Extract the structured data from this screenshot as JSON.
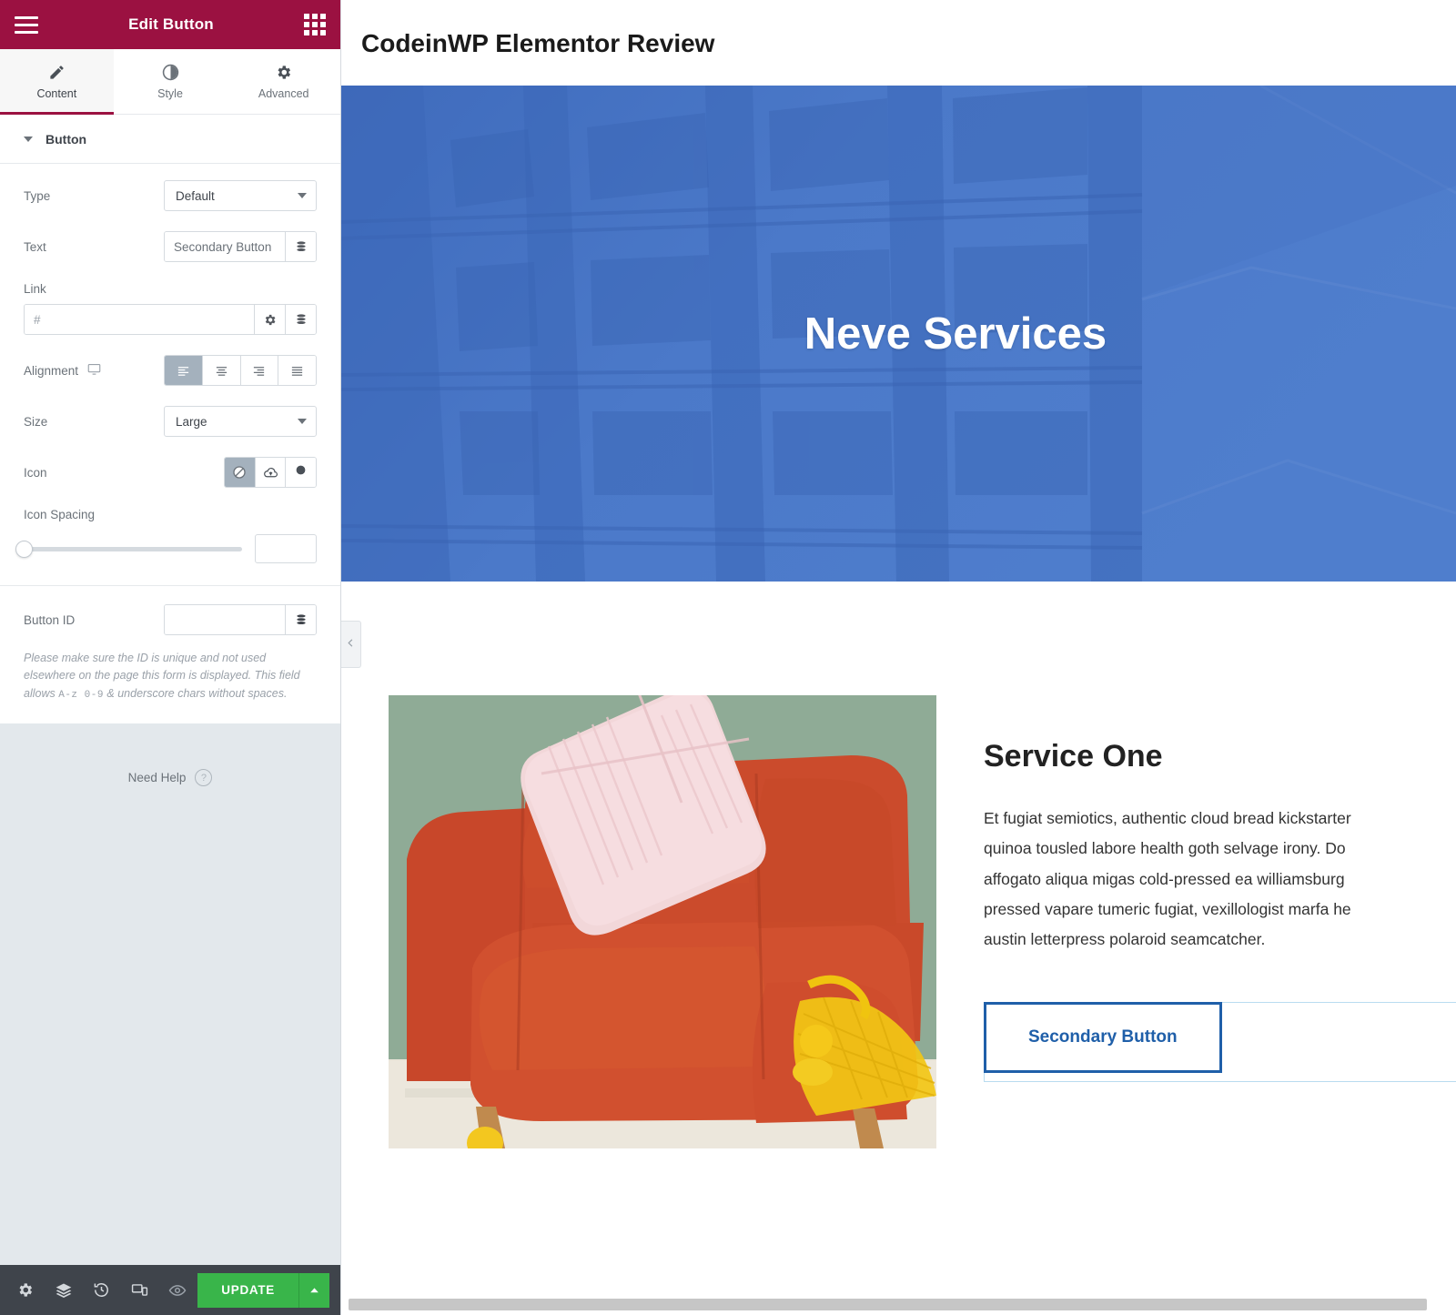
{
  "panel": {
    "header": {
      "title": "Edit Button",
      "menu_icon": "hamburger-icon",
      "widgets_icon": "apps-grid-icon"
    },
    "tabs": [
      {
        "label": "Content",
        "icon": "pencil-icon",
        "active": true
      },
      {
        "label": "Style",
        "icon": "contrast-circle-icon",
        "active": false
      },
      {
        "label": "Advanced",
        "icon": "gear-icon",
        "active": false
      }
    ],
    "section": {
      "title": "Button",
      "collapsed": false
    },
    "controls": {
      "type": {
        "label": "Type",
        "value": "Default"
      },
      "text": {
        "label": "Text",
        "value": "Secondary Button",
        "dynamic_icon": "database-stack-icon"
      },
      "link": {
        "label": "Link",
        "value": "",
        "placeholder": "#",
        "options_icon": "gear-icon",
        "dynamic_icon": "database-stack-icon"
      },
      "alignment": {
        "label": "Alignment",
        "device_icon": "desktop-icon",
        "options": [
          "align-left",
          "align-center",
          "align-right",
          "align-justify"
        ],
        "selected_index": 0
      },
      "size": {
        "label": "Size",
        "value": "Large"
      },
      "icon": {
        "label": "Icon",
        "options": [
          "none-ban-icon",
          "upload-cloud-icon",
          "filled-circle-icon"
        ],
        "selected_index": 0
      },
      "icon_spacing": {
        "label": "Icon Spacing",
        "value": "",
        "slider_percent": 0
      },
      "button_id": {
        "label": "Button ID",
        "value": "",
        "dynamic_icon": "database-stack-icon",
        "helper_part1": "Please make sure the ID is unique and not used elsewhere on the page this form is displayed. This field allows ",
        "helper_mono": "A-z 0-9",
        "helper_part2": " & underscore chars without spaces."
      }
    },
    "need_help": {
      "label": "Need Help",
      "icon": "question-circle-icon"
    },
    "footer": {
      "icons": [
        "gear-icon",
        "layers-icon",
        "history-icon",
        "responsive-preview-icon",
        "eye-preview-icon"
      ],
      "update_label": "UPDATE",
      "update_arrow_icon": "chevron-up-icon"
    }
  },
  "canvas": {
    "page_title": "CodeinWP Elementor Review",
    "hero": {
      "title": "Neve Services",
      "overlay_color": "#4371c0"
    },
    "service": {
      "image_alt": "orange-sofa-photo",
      "heading": "Service One",
      "paragraph": "Et fugiat semiotics, authentic cloud bread kickstarter\nquinoa tousled labore health goth selvage irony. Do\naffogato aliqua migas cold-pressed ea williamsburg\npressed vapare tumeric fugiat, vexillologist marfa he\naustin letterpress polaroid seamcatcher.",
      "button_label": "Secondary Button",
      "button_color": "#1f5fa9"
    },
    "collapse_icon": "chevron-left-icon",
    "scrollbar": "horizontal-scrollbar"
  },
  "colors": {
    "panel_header": "#9b1141",
    "update_green": "#39b54a",
    "footer_dark": "#3f444b",
    "hero_blue": "#4371c0",
    "selection_blue": "#b9dcf0"
  }
}
